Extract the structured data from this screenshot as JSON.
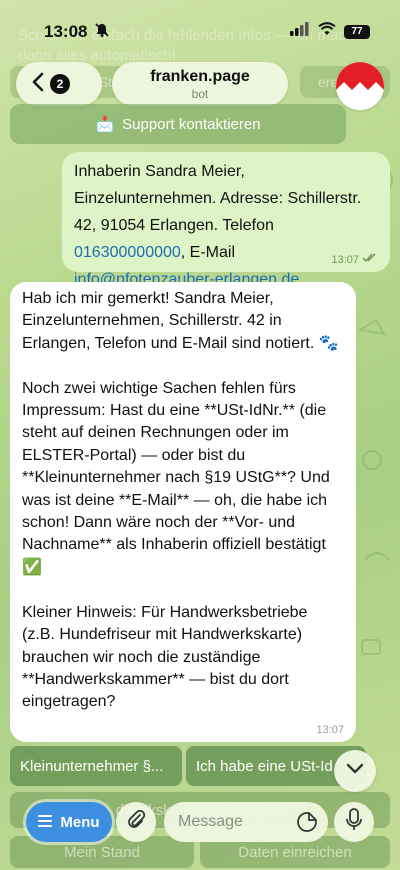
{
  "status_bar": {
    "time": "13:08",
    "battery": "77"
  },
  "ghost": {
    "text": "Schick mir einfach die fehlenden Infos — ich mach dann alles automatisch!",
    "button_left": "Mein Stand",
    "button_right": "ereichen"
  },
  "header": {
    "back_count": "2",
    "title": "franken.page",
    "subtitle": "bot"
  },
  "support_button": {
    "emoji": "📩",
    "label": "Support kontaktieren"
  },
  "message_out": {
    "line1": "Inhaberin Sandra Meier,",
    "line2": "Einzelunternehmen. Adresse: Schillerstr.",
    "line3": "42, 91054 Erlangen. Telefon",
    "phone": "016300000000",
    "email_prefix": ", E-Mail",
    "email": "info@pfotenzauber-erlangen.de",
    "time": "13:07"
  },
  "message_in": {
    "text": "Hab ich mir gemerkt! Sandra Meier, Einzelunternehmen, Schillerstr. 42 in Erlangen, Telefon und E-Mail sind notiert. 🐾\n\nNoch zwei wichtige Sachen fehlen fürs Impressum: Hast du eine **USt-IdNr.** (die steht auf deinen Rechnungen oder im ELSTER-Portal) — oder bist du **Kleinunternehmer nach §19 UStG**? Und was ist deine **E-Mail** — oh, die habe ich schon! Dann wäre noch der **Vor- und Nachname** als Inhaberin offiziell bestätigt ✅\n\nKleiner Hinweis: Für Handwerksbetriebe (z.B. Hundefriseur mit Handwerkskarte) brauchen wir noch die zuständige **Handwerkskammer** — bist du dort eingetragen?",
    "time": "13:07"
  },
  "keyboard": {
    "btn1": "Kleinunternehmer §...",
    "btn2": "Ich habe eine USt-Id",
    "ghost1": "dwerkskammer eintragen",
    "ghost2": "Mein Stand",
    "ghost3": "Daten einreichen"
  },
  "input_bar": {
    "menu_label": "Menu",
    "placeholder": "Message"
  },
  "colors": {
    "accent": "#3d8fe0",
    "outgoing_bubble": "#ddf5c6",
    "link": "#1f6bb5"
  }
}
